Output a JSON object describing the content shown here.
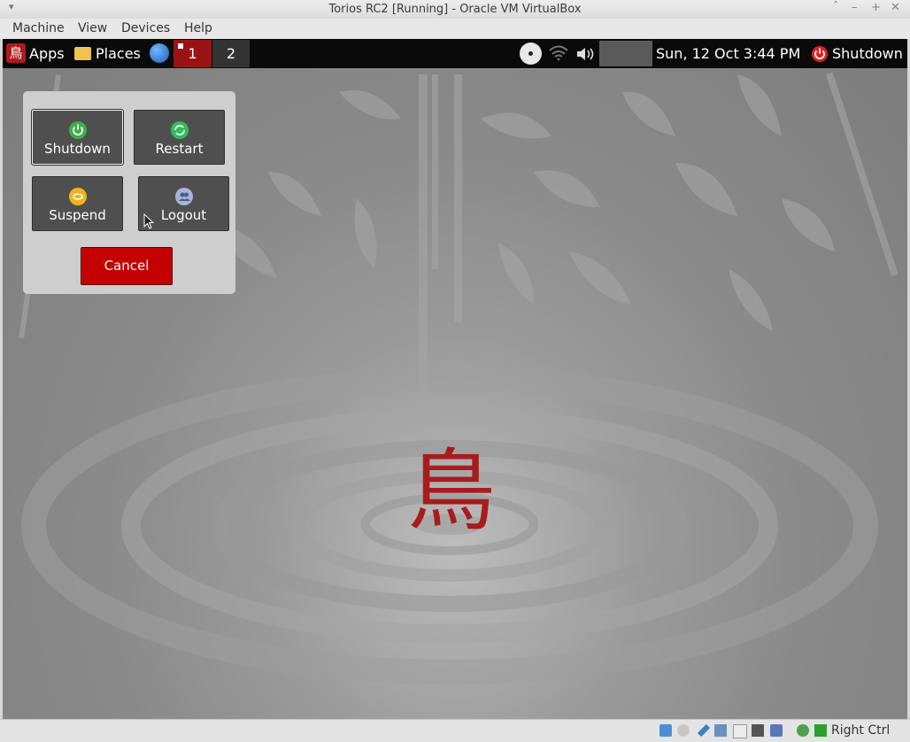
{
  "window": {
    "title": "Torios RC2 [Running] - Oracle VM VirtualBox",
    "menu": [
      "Machine",
      "View",
      "Devices",
      "Help"
    ]
  },
  "panel": {
    "apps_label": "Apps",
    "places_label": "Places",
    "workspaces": [
      "1",
      "2"
    ],
    "datetime": "Sun, 12 Oct  3:44 PM",
    "shutdown_label": "Shutdown"
  },
  "dialog": {
    "shutdown_label": "Shutdown",
    "restart_label": "Restart",
    "suspend_label": "Suspend",
    "logout_label": "Logout",
    "cancel_label": "Cancel"
  },
  "statusbar": {
    "host_key": "Right Ctrl"
  },
  "colors": {
    "accent_red": "#c50000",
    "workspace_active": "#9a1313",
    "power_green": "#3cb04a",
    "restart_green": "#2fbf5a",
    "suspend_yellow": "#f2b418",
    "logout_blue": "#a8b4d8"
  },
  "icons": [
    "menu-icon",
    "folder-icon",
    "globe-icon",
    "cd-icon",
    "wifi-icon",
    "volume-icon",
    "power-icon",
    "restart-icon",
    "suspend-icon",
    "logout-icon"
  ]
}
